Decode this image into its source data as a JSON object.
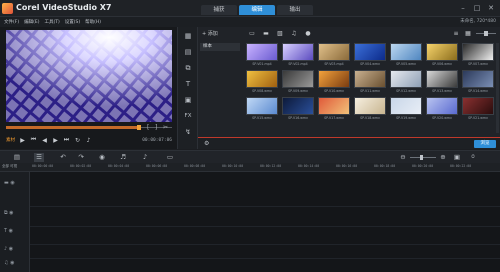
{
  "app": {
    "title": "Corel VideoStudio X7"
  },
  "tabs": [
    {
      "label": "捕获",
      "active": false
    },
    {
      "label": "编辑",
      "active": true
    },
    {
      "label": "输出",
      "active": false
    }
  ],
  "menu": [
    "文件(F)",
    "编辑(E)",
    "工具(T)",
    "设置(S)",
    "帮助(H)"
  ],
  "project_size": "未命名, 720*480",
  "preview": {
    "mode_label": "素材",
    "timecode": "00:00:07:06",
    "progress": 0.8
  },
  "library": {
    "add_label": "添加",
    "folder": "样本",
    "browse_label": "浏览",
    "thumbnails": [
      {
        "label": "SP-V01.mp4",
        "colors": [
          "#c9b3ff",
          "#6a5bd0"
        ]
      },
      {
        "label": "SP-V02.mp4",
        "colors": [
          "#d8d0ff",
          "#5b4bbf"
        ]
      },
      {
        "label": "SP-V03.mp4",
        "colors": [
          "#e0c08a",
          "#8a6a3a"
        ]
      },
      {
        "label": "SP-V04.wmv",
        "colors": [
          "#3b6fd8",
          "#0c2a8a"
        ]
      },
      {
        "label": "SP-V05.wmv",
        "colors": [
          "#bcd7f0",
          "#4f86c0"
        ]
      },
      {
        "label": "SP-V06.wmv",
        "colors": [
          "#f6d36b",
          "#8b6d1c"
        ]
      },
      {
        "label": "SP-V07.wmv",
        "colors": [
          "#2a2a2a",
          "#f0f0f0"
        ]
      },
      {
        "label": "SP-V08.wmv",
        "colors": [
          "#f0c040",
          "#a06010"
        ]
      },
      {
        "label": "SP-V09.wmv",
        "colors": [
          "#3a3a3a",
          "#9a9a9a"
        ]
      },
      {
        "label": "SP-V10.wmv",
        "colors": [
          "#f3a23c",
          "#7a3c10"
        ]
      },
      {
        "label": "SP-V11.wmv",
        "colors": [
          "#c8b090",
          "#6a5030"
        ]
      },
      {
        "label": "SP-V12.wmv",
        "colors": [
          "#e6e9ee",
          "#8fa0b5"
        ]
      },
      {
        "label": "SP-V13.wmv",
        "colors": [
          "#d8d8d8",
          "#3a3a3a"
        ]
      },
      {
        "label": "SP-V14.wmv",
        "colors": [
          "#2c3a5a",
          "#7b8fb5"
        ]
      },
      {
        "label": "SP-V15.wmv",
        "colors": [
          "#c0d8f5",
          "#5b8ad0"
        ]
      },
      {
        "label": "SP-V16.wmv",
        "colors": [
          "#0d1a3a",
          "#2a4f9a"
        ]
      },
      {
        "label": "SP-V17.wmv",
        "colors": [
          "#e05a3a",
          "#f2c27a"
        ]
      },
      {
        "label": "SP-V18.wmv",
        "colors": [
          "#f6efe0",
          "#c8b590"
        ]
      },
      {
        "label": "SP-V19.wmv",
        "colors": [
          "#c9d6e8",
          "#e8eef6"
        ]
      },
      {
        "label": "SP-V20.wmv",
        "colors": [
          "#b8c3f0",
          "#5a6ad0"
        ]
      },
      {
        "label": "SP-V21.wmv",
        "colors": [
          "#8a3030",
          "#2a0d0d"
        ]
      }
    ]
  },
  "timeline": {
    "all_tracks_label": "全部 可视",
    "ruler": [
      "00:00:00:00",
      "00:00:02:00",
      "00:00:04:00",
      "00:00:06:00",
      "00:00:08:00",
      "00:00:10:00",
      "00:00:12:00",
      "00:00:14:00",
      "00:00:16:00",
      "00:00:18:00",
      "00:00:20:00",
      "00:00:22:00"
    ]
  },
  "icons": {
    "logo": "corel-logo-icon",
    "strip": [
      "media-icon",
      "instant-project-icon",
      "transition-icon",
      "title-icon",
      "graphics-icon",
      "fx-icon",
      "path-icon"
    ],
    "tracks": [
      "video-track-icon",
      "overlay-track-icon",
      "title-track-icon",
      "voice-track-icon",
      "music-track-icon"
    ]
  },
  "colors": {
    "accent": "#2f8fd8",
    "scrub": "#f2a23a"
  }
}
